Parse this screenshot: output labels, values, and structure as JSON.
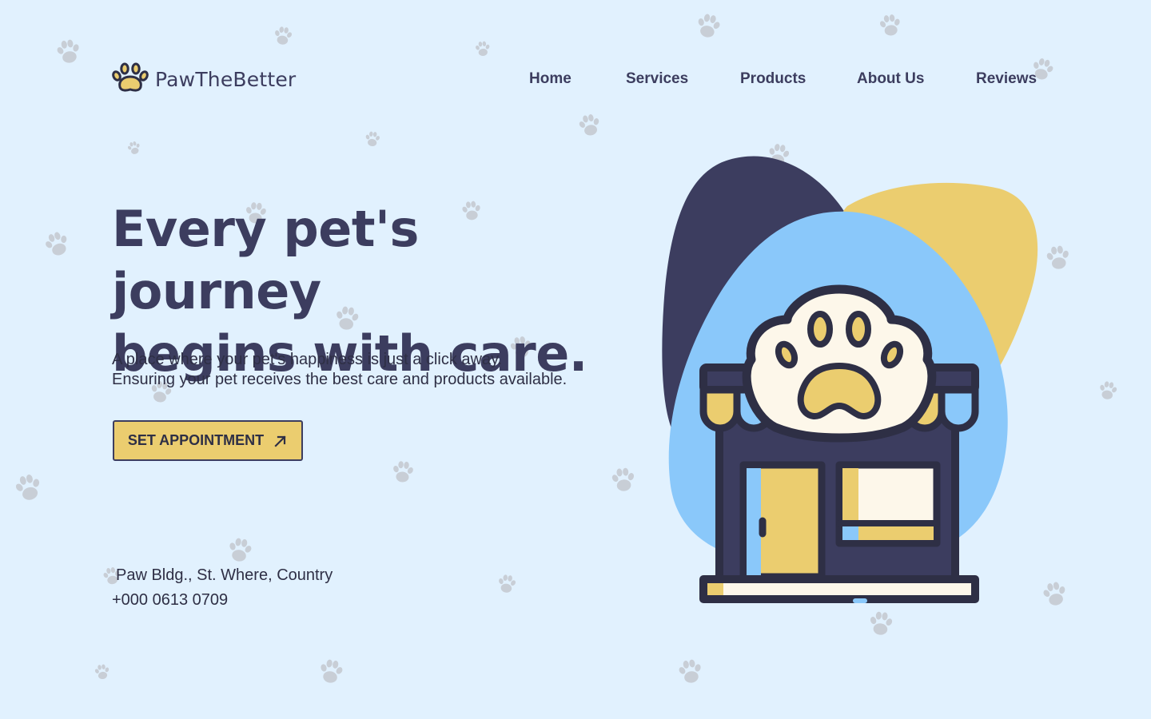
{
  "brand": {
    "name": "PawTheBetter",
    "logo_icon": "paw-icon"
  },
  "nav": {
    "items": [
      {
        "label": "Home"
      },
      {
        "label": "Services"
      },
      {
        "label": "Products"
      },
      {
        "label": "About Us"
      },
      {
        "label": "Reviews"
      }
    ]
  },
  "hero": {
    "headline_line1": "Every pet's journey",
    "headline_line2": "begins with care.",
    "subtitle_line1": "A place where your pet's happiness is just a click away.",
    "subtitle_line2": "Ensuring your pet receives the best care and products available.",
    "cta_label": "SET APPOINTMENT",
    "cta_icon": "arrow-up-right-icon"
  },
  "contact": {
    "address": "Paw Bldg., St. Where, Country",
    "phone": "+000 0613 0709"
  },
  "illustration": {
    "icon": "pet-shop-storefront-icon"
  },
  "colors": {
    "background": "#e1f1fe",
    "navy": "#3c3d5f",
    "yellow": "#ebcd6f",
    "light_blue": "#8ac8fa",
    "cream": "#fdf7ea",
    "paw_pattern": "#c8ced6"
  }
}
